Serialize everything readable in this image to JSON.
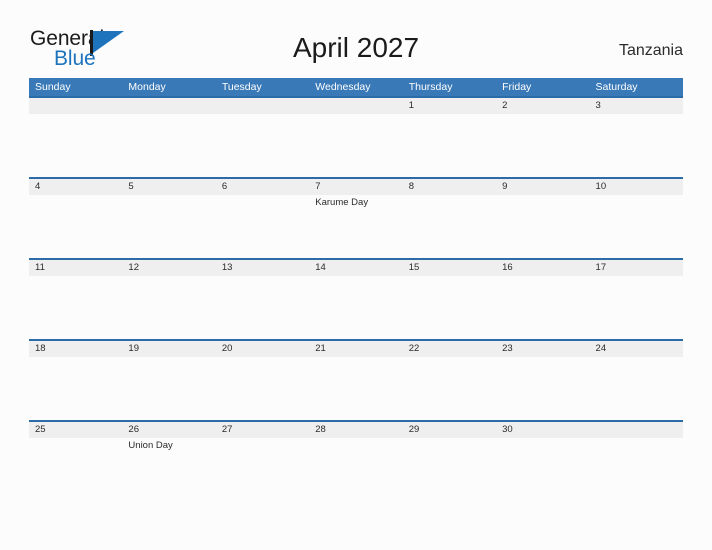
{
  "brand": {
    "name_part1": "General",
    "name_part2": "Blue",
    "flag_icon": "flag-icon",
    "accent_color": "#1d74bd"
  },
  "header": {
    "title": "April 2027",
    "country": "Tanzania"
  },
  "theme": {
    "header_blue": "#3a79b8",
    "row_border_blue": "#2a6ba8",
    "band_gray": "#efeff0",
    "page_background": "#fcfcfd",
    "text_color": "#2b2b2b"
  },
  "calendar": {
    "weekdays": [
      "Sunday",
      "Monday",
      "Tuesday",
      "Wednesday",
      "Thursday",
      "Friday",
      "Saturday"
    ],
    "weeks": [
      {
        "days": [
          {
            "num": "",
            "event": ""
          },
          {
            "num": "",
            "event": ""
          },
          {
            "num": "",
            "event": ""
          },
          {
            "num": "",
            "event": ""
          },
          {
            "num": "1",
            "event": ""
          },
          {
            "num": "2",
            "event": ""
          },
          {
            "num": "3",
            "event": ""
          }
        ]
      },
      {
        "days": [
          {
            "num": "4",
            "event": ""
          },
          {
            "num": "5",
            "event": ""
          },
          {
            "num": "6",
            "event": ""
          },
          {
            "num": "7",
            "event": "Karume Day"
          },
          {
            "num": "8",
            "event": ""
          },
          {
            "num": "9",
            "event": ""
          },
          {
            "num": "10",
            "event": ""
          }
        ]
      },
      {
        "days": [
          {
            "num": "11",
            "event": ""
          },
          {
            "num": "12",
            "event": ""
          },
          {
            "num": "13",
            "event": ""
          },
          {
            "num": "14",
            "event": ""
          },
          {
            "num": "15",
            "event": ""
          },
          {
            "num": "16",
            "event": ""
          },
          {
            "num": "17",
            "event": ""
          }
        ]
      },
      {
        "days": [
          {
            "num": "18",
            "event": ""
          },
          {
            "num": "19",
            "event": ""
          },
          {
            "num": "20",
            "event": ""
          },
          {
            "num": "21",
            "event": ""
          },
          {
            "num": "22",
            "event": ""
          },
          {
            "num": "23",
            "event": ""
          },
          {
            "num": "24",
            "event": ""
          }
        ]
      },
      {
        "days": [
          {
            "num": "25",
            "event": ""
          },
          {
            "num": "26",
            "event": "Union Day"
          },
          {
            "num": "27",
            "event": ""
          },
          {
            "num": "28",
            "event": ""
          },
          {
            "num": "29",
            "event": ""
          },
          {
            "num": "30",
            "event": ""
          },
          {
            "num": "",
            "event": ""
          }
        ]
      }
    ]
  }
}
